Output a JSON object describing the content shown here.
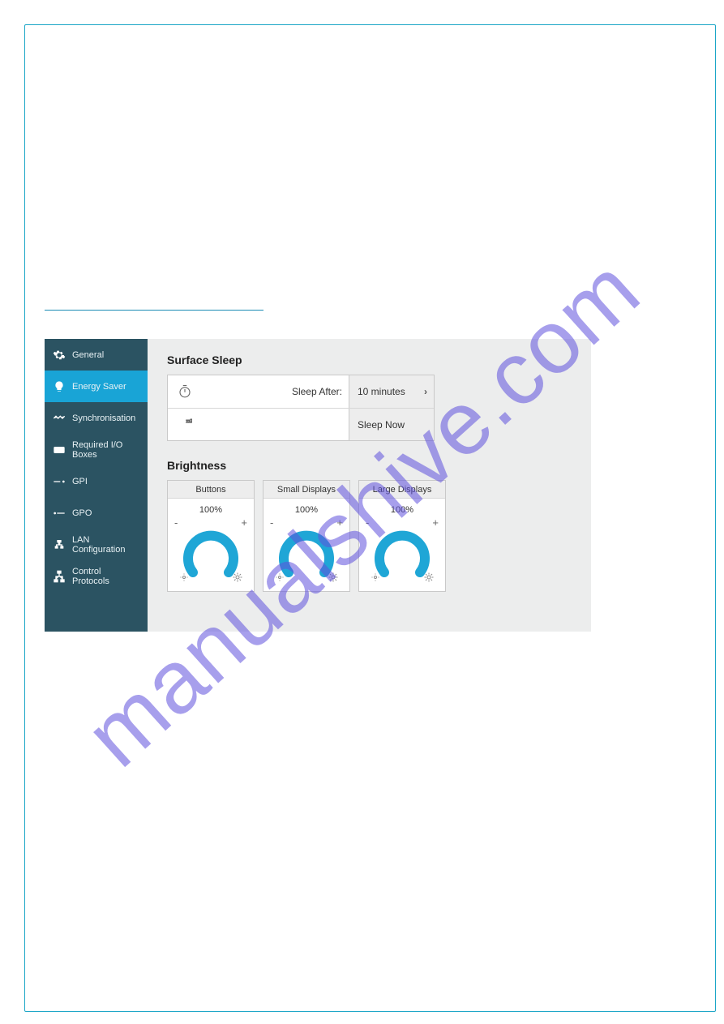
{
  "watermark": "manualshive.com",
  "figure_caption": "",
  "sidebar": {
    "items": [
      {
        "label": "General"
      },
      {
        "label": "Energy Saver"
      },
      {
        "label": "Synchronisation"
      },
      {
        "label": "Required I/O Boxes"
      },
      {
        "label": "GPI"
      },
      {
        "label": "GPO"
      },
      {
        "label": "LAN Configuration"
      },
      {
        "label": "Control Protocols"
      }
    ],
    "active_index": 1
  },
  "main": {
    "surface_sleep": {
      "title": "Surface Sleep",
      "sleep_after_label": "Sleep After:",
      "sleep_after_value": "10 minutes",
      "sleep_now_label": "Sleep Now"
    },
    "brightness": {
      "title": "Brightness",
      "cards": [
        {
          "name": "Buttons",
          "value": "100%"
        },
        {
          "name": "Small Displays",
          "value": "100%"
        },
        {
          "name": "Large Displays",
          "value": "100%"
        }
      ],
      "minus": "-",
      "plus": "+"
    }
  }
}
